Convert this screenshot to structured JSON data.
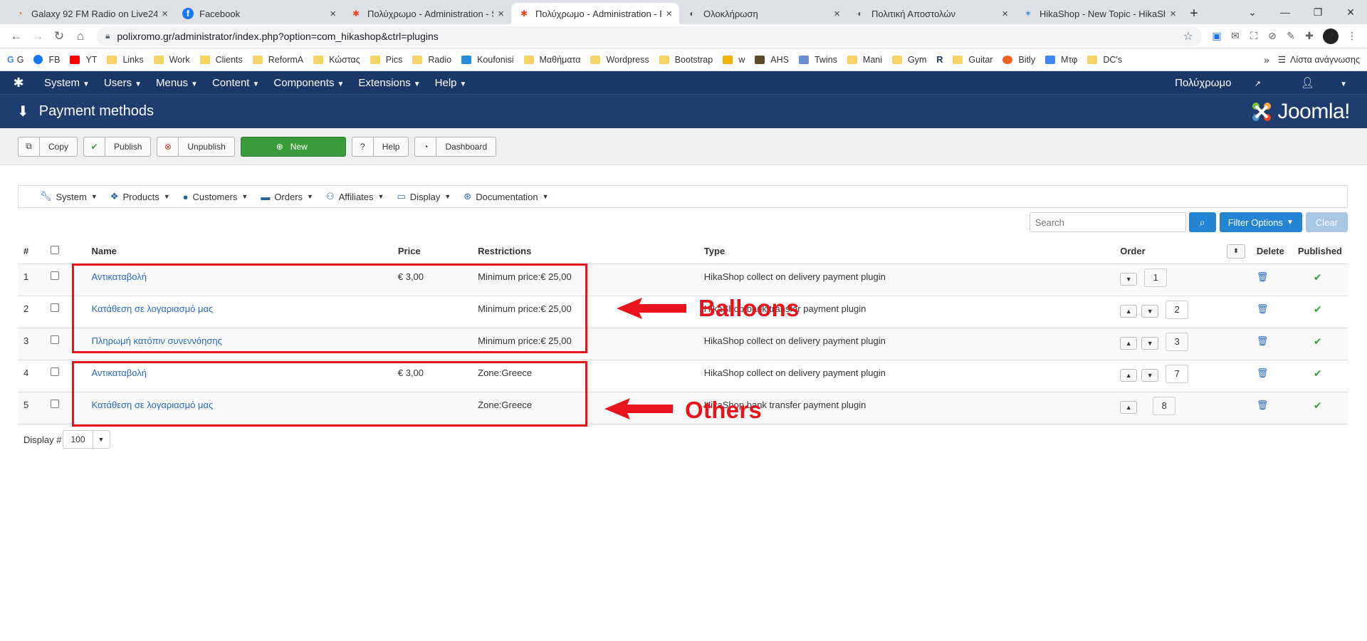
{
  "browser": {
    "tabs": [
      {
        "title": "Galaxy 92 FM Radio on Live24.gr",
        "icon": "rss-icon"
      },
      {
        "title": "Facebook",
        "icon": "facebook-icon"
      },
      {
        "title": "Πολύχρωμο - Administration - S",
        "icon": "joomla-icon"
      },
      {
        "title": "Πολύχρωμο - Administration - P",
        "icon": "joomla-icon",
        "active": true
      },
      {
        "title": "Ολοκλήρωση",
        "icon": "hikashop-icon"
      },
      {
        "title": "Πολιτική Αποστολών",
        "icon": "hikashop-icon"
      },
      {
        "title": "HikaShop - New Topic - HikaSho",
        "icon": "hikashop-icon"
      }
    ],
    "url": "polixromo.gr/administrator/index.php?option=com_hikashop&ctrl=plugins",
    "bookmarks": [
      "G",
      "FB",
      "YT",
      "Links",
      "Work",
      "Clients",
      "ReformA",
      "Κώστας",
      "Pics",
      "Radio",
      "Koufonisi",
      "Μαθήματα",
      "Wordpress",
      "Bootstrap",
      "w",
      "AHS",
      "Twins",
      "Mani",
      "Gym",
      "R",
      "Guitar",
      "Bitly",
      "Μτφ",
      "DC's"
    ],
    "reading_list": "Λίστα ανάγνωσης"
  },
  "jnav": {
    "menus": [
      "System",
      "Users",
      "Menus",
      "Content",
      "Components",
      "Extensions",
      "Help"
    ],
    "site_name": "Πολύχρωμο"
  },
  "header": {
    "title": "Payment methods",
    "brand": "Joomla!"
  },
  "toolbar": {
    "copy": "Copy",
    "publish": "Publish",
    "unpublish": "Unpublish",
    "new": "New",
    "help": "Help",
    "dashboard": "Dashboard"
  },
  "submenu": [
    "System",
    "Products",
    "Customers",
    "Orders",
    "Affiliates",
    "Display",
    "Documentation"
  ],
  "search": {
    "placeholder": "Search",
    "filter_label": "Filter Options",
    "clear_label": "Clear"
  },
  "table": {
    "headers": {
      "num": "#",
      "name": "Name",
      "price": "Price",
      "restrictions": "Restrictions",
      "type": "Type",
      "order": "Order",
      "delete": "Delete",
      "published": "Published"
    },
    "rows": [
      {
        "num": "1",
        "name": "Αντικαταβολή",
        "price": "€ 3,00",
        "restrictions": "Minimum price:€ 25,00",
        "type": "HikaShop collect on delivery payment plugin",
        "order": "1"
      },
      {
        "num": "2",
        "name": "Κατάθεση σε λογαριασμό μας",
        "price": "",
        "restrictions": "Minimum price:€ 25,00",
        "type": "HikaShop bank transfer payment plugin",
        "order": "2"
      },
      {
        "num": "3",
        "name": "Πληρωμή κατόπιν συνεννόησης",
        "price": "",
        "restrictions": "Minimum price:€ 25,00",
        "type": "HikaShop collect on delivery payment plugin",
        "order": "3"
      },
      {
        "num": "4",
        "name": "Αντικαταβολή",
        "price": "€ 3,00",
        "restrictions": "Zone:Greece",
        "type": "HikaShop collect on delivery payment plugin",
        "order": "7"
      },
      {
        "num": "5",
        "name": "Κατάθεση σε λογαριασμό μας",
        "price": "",
        "restrictions": "Zone:Greece",
        "type": "HikaShop bank transfer payment plugin",
        "order": "8"
      }
    ]
  },
  "display": {
    "label": "Display #",
    "value": "100"
  },
  "annotations": {
    "balloons": "Balloons",
    "others": "Others"
  },
  "colors": {
    "joomla_nav": "#1a3867",
    "annotation_red": "#e8131b",
    "primary_blue": "#2384d3",
    "new_green": "#3a9b3a"
  }
}
